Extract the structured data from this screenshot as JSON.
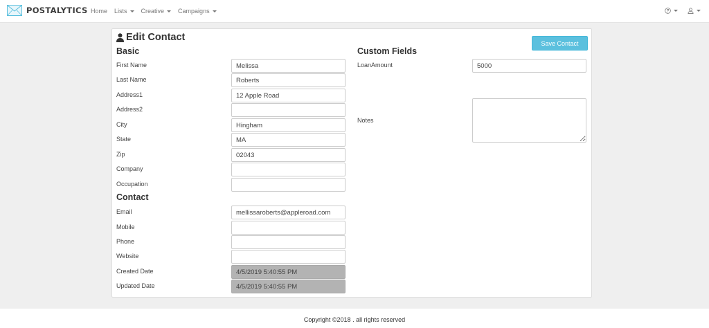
{
  "brand": {
    "name": "POSTALYTICS",
    "icon": "envelope-logo"
  },
  "nav": {
    "home": "Home",
    "lists": "Lists",
    "creative": "Creative",
    "campaigns": "Campaigns",
    "help_icon": "help-circle-icon",
    "user_icon": "user-icon"
  },
  "page": {
    "title": "Edit Contact",
    "title_icon": "user-icon",
    "save_label": "Save Contact"
  },
  "basic": {
    "title": "Basic",
    "fields": [
      {
        "label": "First Name",
        "value": "Melissa"
      },
      {
        "label": "Last Name",
        "value": "Roberts"
      },
      {
        "label": "Address1",
        "value": "12 Apple Road"
      },
      {
        "label": "Address2",
        "value": ""
      },
      {
        "label": "City",
        "value": "Hingham"
      },
      {
        "label": "State",
        "value": "MA"
      },
      {
        "label": "Zip",
        "value": "02043"
      },
      {
        "label": "Company",
        "value": ""
      },
      {
        "label": "Occupation",
        "value": ""
      }
    ]
  },
  "contact": {
    "title": "Contact",
    "fields": [
      {
        "label": "Email",
        "value": "mellissaroberts@appleroad.com"
      },
      {
        "label": "Mobile",
        "value": ""
      },
      {
        "label": "Phone",
        "value": ""
      },
      {
        "label": "Website",
        "value": ""
      },
      {
        "label": "Created Date",
        "value": "4/5/2019 5:40:55 PM"
      },
      {
        "label": "Updated Date",
        "value": "4/5/2019 5:40:55 PM"
      }
    ]
  },
  "custom": {
    "title": "Custom Fields",
    "loan_label": "LoanAmount",
    "loan_value": "5000",
    "notes_label": "Notes",
    "notes_value": ""
  },
  "footer": {
    "text": "Copyright ©2018 . all rights reserved"
  },
  "colors": {
    "accent": "#5bc0de",
    "readonly": "#b3b3b3",
    "logo": "#5bc0de"
  }
}
